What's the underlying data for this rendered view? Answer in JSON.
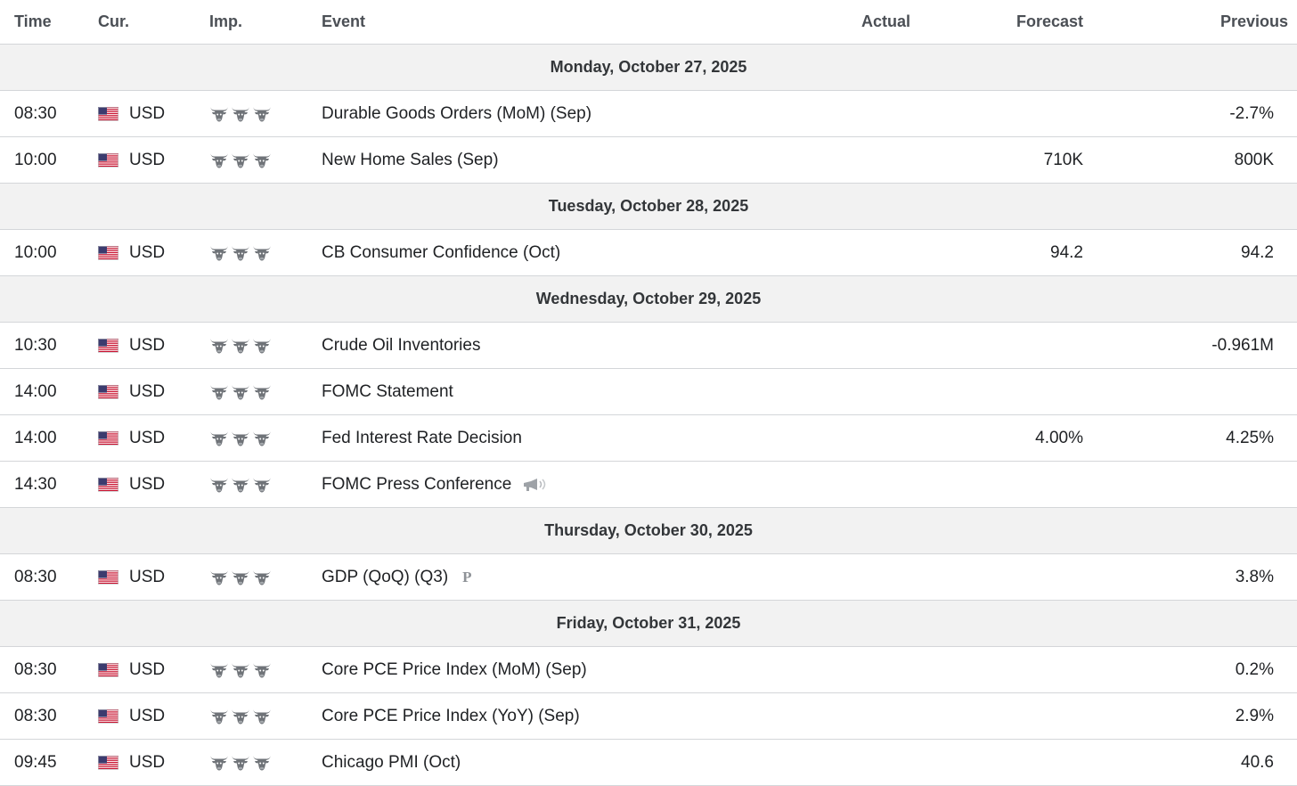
{
  "header": {
    "time": "Time",
    "currency": "Cur.",
    "importance": "Imp.",
    "event": "Event",
    "actual": "Actual",
    "forecast": "Forecast",
    "previous": "Previous"
  },
  "days": [
    {
      "label": "Monday, October 27, 2025",
      "events": [
        {
          "time": "08:30",
          "currency": "USD",
          "importance": 3,
          "name": "Durable Goods Orders (MoM) (Sep)",
          "actual": "",
          "forecast": "",
          "previous": "-2.7%"
        },
        {
          "time": "10:00",
          "currency": "USD",
          "importance": 3,
          "name": "New Home Sales (Sep)",
          "actual": "",
          "forecast": "710K",
          "previous": "800K"
        }
      ]
    },
    {
      "label": "Tuesday, October 28, 2025",
      "events": [
        {
          "time": "10:00",
          "currency": "USD",
          "importance": 3,
          "name": "CB Consumer Confidence (Oct)",
          "actual": "",
          "forecast": "94.2",
          "previous": "94.2"
        }
      ]
    },
    {
      "label": "Wednesday, October 29, 2025",
      "events": [
        {
          "time": "10:30",
          "currency": "USD",
          "importance": 3,
          "name": "Crude Oil Inventories",
          "actual": "",
          "forecast": "",
          "previous": "-0.961M"
        },
        {
          "time": "14:00",
          "currency": "USD",
          "importance": 3,
          "name": "FOMC Statement",
          "actual": "",
          "forecast": "",
          "previous": ""
        },
        {
          "time": "14:00",
          "currency": "USD",
          "importance": 3,
          "name": "Fed Interest Rate Decision",
          "actual": "",
          "forecast": "4.00%",
          "previous": "4.25%"
        },
        {
          "time": "14:30",
          "currency": "USD",
          "importance": 3,
          "name": "FOMC Press Conference",
          "actual": "",
          "forecast": "",
          "previous": "",
          "extra_icon": "speech-icon"
        }
      ]
    },
    {
      "label": "Thursday, October 30, 2025",
      "events": [
        {
          "time": "08:30",
          "currency": "USD",
          "importance": 3,
          "name": "GDP (QoQ) (Q3)",
          "actual": "",
          "forecast": "",
          "previous": "3.8%",
          "extra_icon": "preliminary-icon",
          "extra_text": "P"
        }
      ]
    },
    {
      "label": "Friday, October 31, 2025",
      "events": [
        {
          "time": "08:30",
          "currency": "USD",
          "importance": 3,
          "name": "Core PCE Price Index (MoM) (Sep)",
          "actual": "",
          "forecast": "",
          "previous": "0.2%"
        },
        {
          "time": "08:30",
          "currency": "USD",
          "importance": 3,
          "name": "Core PCE Price Index (YoY) (Sep)",
          "actual": "",
          "forecast": "",
          "previous": "2.9%"
        },
        {
          "time": "09:45",
          "currency": "USD",
          "importance": 3,
          "name": "Chicago PMI (Oct)",
          "actual": "",
          "forecast": "",
          "previous": "40.6"
        }
      ]
    }
  ],
  "icons": {
    "flag": "us-flag-icon",
    "importance": "bull-icon"
  },
  "colors": {
    "day_band": "#f2f2f2",
    "border": "#d4d6d9",
    "bull": "#6f7378",
    "flag_red": "#c8102e",
    "flag_blue": "#3c3b6e"
  }
}
